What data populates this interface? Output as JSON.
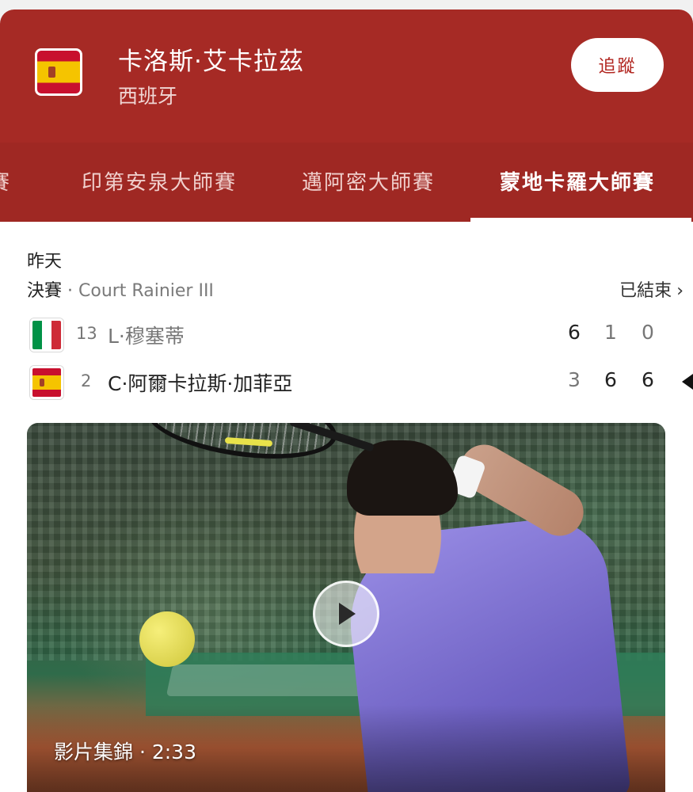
{
  "header": {
    "player_name": "卡洛斯·艾卡拉茲",
    "country": "西班牙",
    "follow_label": "追蹤",
    "flag": "spain-flag"
  },
  "tabs": [
    {
      "label": "賽"
    },
    {
      "label": "印第安泉大師賽"
    },
    {
      "label": "邁阿密大師賽"
    },
    {
      "label": "蒙地卡羅大師賽",
      "active": true
    }
  ],
  "match": {
    "date": "昨天",
    "round": "決賽",
    "separator": " · ",
    "court": "Court Rainier III",
    "status": "已結束",
    "players": [
      {
        "flag": "italy-flag",
        "seed": "13",
        "name": "L·穆塞蒂",
        "sets": [
          "6",
          "1",
          "0"
        ],
        "set_wins": [
          true,
          false,
          false
        ],
        "winner": false
      },
      {
        "flag": "spain-flag",
        "seed": "2",
        "name": "C·阿爾卡拉斯·加菲亞",
        "sets": [
          "3",
          "6",
          "6"
        ],
        "set_wins": [
          false,
          true,
          true
        ],
        "winner": true
      }
    ]
  },
  "video": {
    "caption": "影片集錦 · 2:33",
    "icon": "play-icon"
  },
  "colors": {
    "header_bg": "#a62a25",
    "follow_text": "#b1251f"
  }
}
